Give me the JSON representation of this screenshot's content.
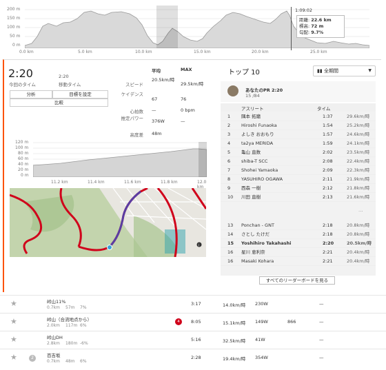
{
  "top_chart": {
    "y_ticks": [
      "200 m",
      "150 m",
      "100 m",
      "50 m",
      "0 m"
    ],
    "x_ticks": [
      "0.0 km",
      "5.0 km",
      "10.0 km",
      "15.0 km",
      "20.0 km",
      "25.0 km"
    ],
    "hover_time": "1:09:02",
    "tooltip": {
      "distance_label": "距離:",
      "distance": "22.6 km",
      "elevation_label": "標高:",
      "elevation": "72 m",
      "grade_label": "勾配:",
      "grade": "9.7%"
    }
  },
  "effort": {
    "time": "2:20",
    "time_label": "今回のタイム",
    "moving_time": "2:20",
    "moving_label": "移動タイム",
    "analysis_button": "分析",
    "goal_button": "目標を設定",
    "compare_button": "比較"
  },
  "stats": {
    "col_avg": "平均",
    "col_max": "MAX",
    "rows": [
      {
        "label": "スピード",
        "avg": "20.5km/時",
        "max": "29.5km/時"
      },
      {
        "label": "ケイデンス",
        "avg": "67",
        "max": "76"
      },
      {
        "label": "心拍数",
        "avg": "—",
        "max": "0 bpm"
      },
      {
        "label": "推定パワー",
        "avg": "376W",
        "max": "—"
      },
      {
        "label": "高度差",
        "avg": "48m",
        "max": ""
      }
    ]
  },
  "segment_chart": {
    "y_ticks": [
      "120 m",
      "100 m",
      "80 m",
      "60 m",
      "40 m",
      "20 m",
      "0 m"
    ],
    "x_ticks": [
      "11.2 km",
      "11.4 km",
      "11.6 km",
      "11.8 km",
      "12.0 km"
    ]
  },
  "leaderboard": {
    "title": "トップ 10",
    "filter": "全期間",
    "my_pr_label": "あなたのPR 2:20",
    "my_pr_rank": "15 /84",
    "col_athlete": "アスリート",
    "col_time": "タイム",
    "rows": [
      {
        "rank": "1",
        "name": "隅本 拓磨",
        "time": "1:37",
        "speed": "29.6km/時"
      },
      {
        "rank": "2",
        "name": "Hiroshi Funaoka",
        "time": "1:54",
        "speed": "25.2km/時"
      },
      {
        "rank": "3",
        "name": "よしき おおもり",
        "time": "1:57",
        "speed": "24.6km/時"
      },
      {
        "rank": "4",
        "name": "ta2ya MERIDA",
        "time": "1:59",
        "speed": "24.1km/時"
      },
      {
        "rank": "5",
        "name": "亀山 直数",
        "time": "2:02",
        "speed": "23.5km/時"
      },
      {
        "rank": "6",
        "name": "shiba-T SCC",
        "time": "2:08",
        "speed": "22.4km/時"
      },
      {
        "rank": "7",
        "name": "Shohei Yamaoka",
        "time": "2:09",
        "speed": "22.3km/時"
      },
      {
        "rank": "8",
        "name": "YASUHIRO OGAWA",
        "time": "2:11",
        "speed": "21.9km/時"
      },
      {
        "rank": "9",
        "name": "西森 一樹",
        "time": "2:12",
        "speed": "21.8km/時"
      },
      {
        "rank": "10",
        "name": "川田 直樹",
        "time": "2:13",
        "speed": "21.6km/時"
      },
      {
        "rank": "13",
        "name": "Ponchan - GNT",
        "time": "2:18",
        "speed": "20.8km/時"
      },
      {
        "rank": "14",
        "name": "さとし たけだ",
        "time": "2:18",
        "speed": "20.8km/時"
      },
      {
        "rank": "15",
        "name": "Yoshihiro Takahashi",
        "time": "2:20",
        "speed": "20.5km/時"
      },
      {
        "rank": "16",
        "name": "星川 恵利奈",
        "time": "2:21",
        "speed": "20.4km/時"
      },
      {
        "rank": "16",
        "name": "Masaki Kohara",
        "time": "2:21",
        "speed": "20.4km/時"
      }
    ],
    "view_all": "すべてのリーダーボードを見る"
  },
  "segments": [
    {
      "name": "峠山11%",
      "dist": "0.7km",
      "elev": "57m",
      "grade": "7%",
      "badge": "",
      "time": "3:17",
      "speed": "14.0km/時",
      "power": "230W",
      "hr": "",
      "extra": "—"
    },
    {
      "name": "峠山（合流地点から）",
      "dist": "2.0km",
      "elev": "117m",
      "grade": "6%",
      "badge": "4",
      "time": "8:05",
      "speed": "15.1km/時",
      "power": "149W",
      "hr": "866",
      "extra": "—"
    },
    {
      "name": "峠山DH",
      "dist": "2.8km",
      "elev": "180m",
      "grade": "-6%",
      "badge": "",
      "time": "5:16",
      "speed": "32.5km/時",
      "power": "41W",
      "hr": "",
      "extra": "—"
    },
    {
      "name": "百吉坂",
      "dist": "0.7km",
      "elev": "48m",
      "grade": "6%",
      "badge": "",
      "time": "2:28",
      "speed": "19.4km/時",
      "power": "354W",
      "hr": "",
      "extra": "—"
    }
  ],
  "colors": {
    "accent": "#fc5200",
    "route": "#d0021b",
    "highlight": "#5a3da3"
  }
}
